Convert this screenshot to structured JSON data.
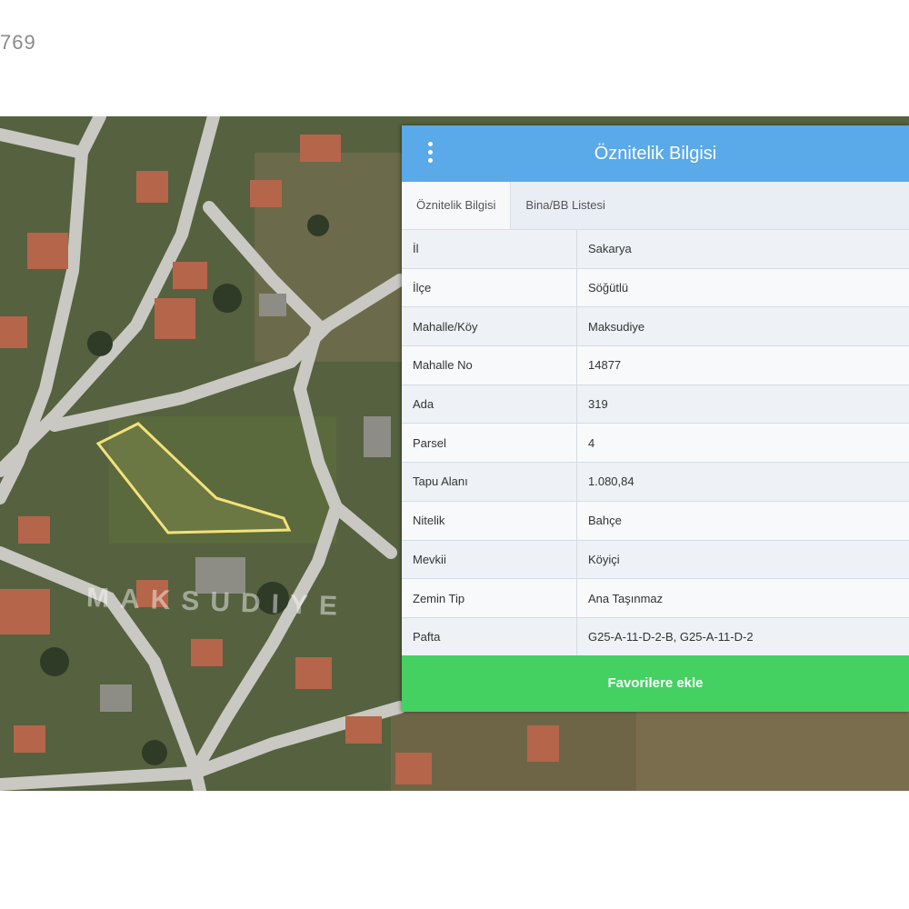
{
  "page": {
    "corner_id": "769"
  },
  "map": {
    "place_label": "MAKSUDIYE"
  },
  "panel": {
    "title": "Öznitelik Bilgisi",
    "tabs": [
      {
        "label": "Öznitelik Bilgisi",
        "active": true
      },
      {
        "label": "Bina/BB Listesi",
        "active": false
      }
    ],
    "rows": [
      {
        "key": "İl",
        "value": "Sakarya"
      },
      {
        "key": "İlçe",
        "value": "Söğütlü"
      },
      {
        "key": "Mahalle/Köy",
        "value": "Maksudiye"
      },
      {
        "key": "Mahalle No",
        "value": "14877"
      },
      {
        "key": "Ada",
        "value": "319"
      },
      {
        "key": "Parsel",
        "value": "4"
      },
      {
        "key": "Tapu Alanı",
        "value": "1.080,84"
      },
      {
        "key": "Nitelik",
        "value": "Bahçe"
      },
      {
        "key": "Mevkii",
        "value": "Köyiçi"
      },
      {
        "key": "Zemin Tip",
        "value": "Ana Taşınmaz"
      },
      {
        "key": "Pafta",
        "value": "G25-A-11-D-2-B, G25-A-11-D-2"
      }
    ],
    "favorite_button": "Favorilere ekle"
  },
  "colors": {
    "header": "#5aa9e8",
    "button": "#44d162",
    "parcel_outline": "#f2e27a"
  }
}
